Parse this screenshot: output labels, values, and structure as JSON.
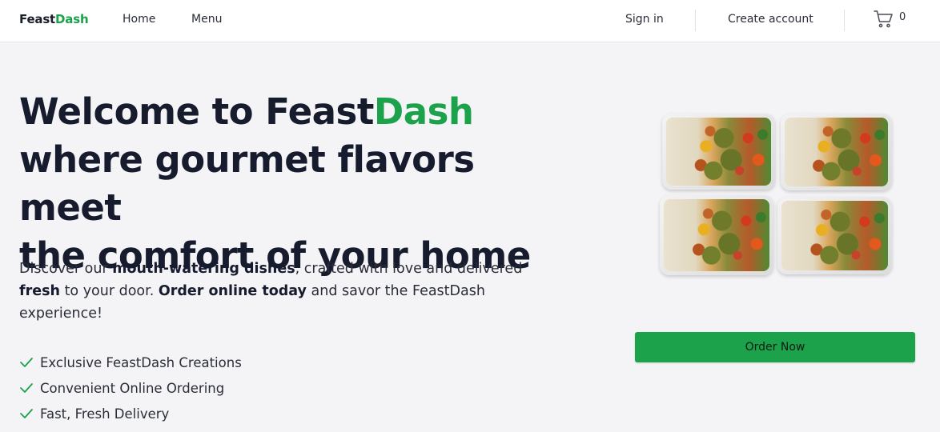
{
  "header": {
    "logo_part1": "Feast",
    "logo_part2": "Dash",
    "nav": {
      "home": "Home",
      "menu": "Menu"
    },
    "sign_in": "Sign in",
    "create_account": "Create account",
    "cart_icon": "shopping-cart-icon",
    "cart_count": "0"
  },
  "hero": {
    "title_line1_prefix": "Welcome to Feast",
    "title_line1_accent": "Dash",
    "title_line2": "where gourmet flavors meet",
    "title_line3": "the comfort of your home",
    "desc": {
      "t1": "Discover our ",
      "b1": "mouth-watering dishes",
      "t2": ", crafted with love and delivered ",
      "b2": "fresh",
      "t3": " to your door. ",
      "b3": "Order online today",
      "t4": " and savor the FeastDash experience!"
    },
    "features": [
      "Exclusive FeastDash Creations",
      "Convenient Online Ordering",
      "Fast, Fresh Delivery"
    ],
    "check_icon": "checkmark-icon",
    "order_button": "Order Now"
  },
  "colors": {
    "accent": "#1ba24a",
    "heading": "#171b2e",
    "background": "#f4f4f7",
    "header_bg": "#ffffff"
  }
}
